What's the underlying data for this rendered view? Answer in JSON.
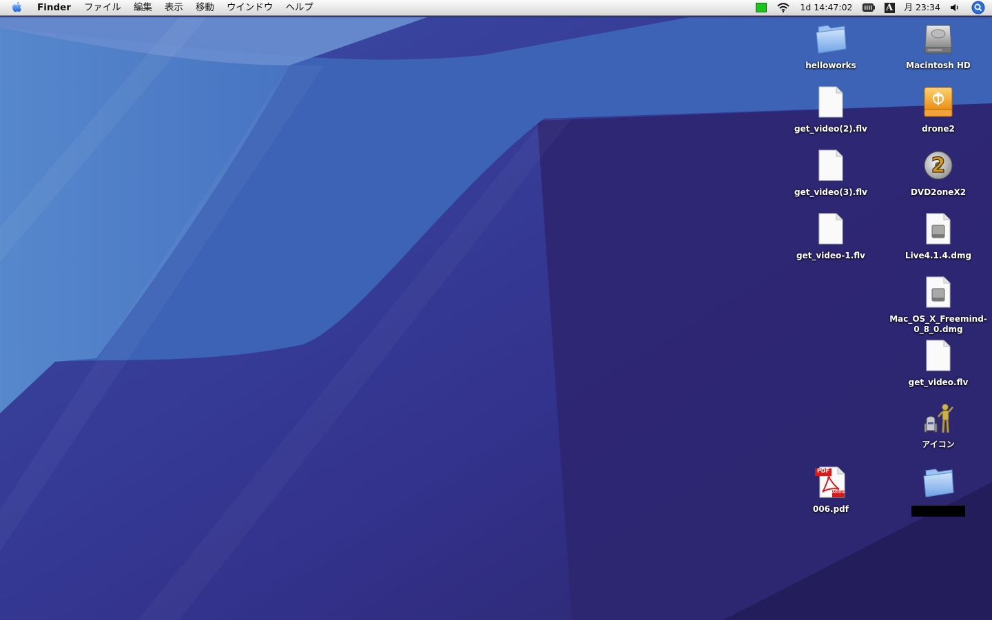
{
  "menubar": {
    "app_name": "Finder",
    "menus": [
      "ファイル",
      "編集",
      "表示",
      "移動",
      "ウインドウ",
      "ヘルプ"
    ],
    "status": {
      "uptime": "1d 14:47:02",
      "input_source": "A",
      "clock": "月 23:34"
    }
  },
  "desktop": {
    "icons": [
      {
        "label": "helloworks",
        "type": "folder"
      },
      {
        "label": "Macintosh HD",
        "type": "hard-drive"
      },
      {
        "label": "get_video(2).flv",
        "type": "document"
      },
      {
        "label": "drone2",
        "type": "firewire-drive"
      },
      {
        "label": "get_video(3).flv",
        "type": "document"
      },
      {
        "label": "DVD2oneX2",
        "type": "application"
      },
      {
        "label": "get_video-1.flv",
        "type": "document"
      },
      {
        "label": "Live4.1.4.dmg",
        "type": "disk-image"
      },
      {
        "label": "Mac_OS_X_Freemind-0_8_0.dmg",
        "type": "disk-image"
      },
      {
        "label": "get_video.flv",
        "type": "document"
      },
      {
        "label": "アイコン",
        "type": "robot-figures"
      },
      {
        "label": "006.pdf",
        "type": "pdf"
      },
      {
        "label": "",
        "type": "folder",
        "label_redacted": true
      }
    ],
    "pdf_badge": "PDF",
    "adobe_text": "Adobe"
  },
  "colors": {
    "wallpaper_dark": "#2e2a74",
    "wallpaper_mid": "#3a45a0",
    "wallpaper_light": "#4a7ec6",
    "battery_green": "#1cc51c",
    "spotlight_blue": "#2a6fd8"
  }
}
